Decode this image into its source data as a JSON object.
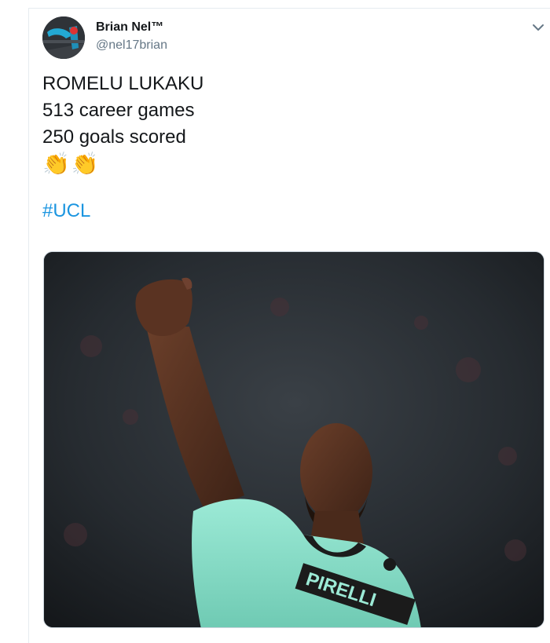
{
  "tweet": {
    "author": {
      "display_name": "Brian Nel™",
      "handle": "@nel17brian"
    },
    "text_lines": [
      "ROMELU LUKAKU",
      "513 career games",
      "250 goals scored"
    ],
    "emojis": [
      "👏",
      "👏"
    ],
    "hashtag": "#UCL",
    "media": {
      "kind": "photo",
      "shirt_text": "PIRELLI"
    }
  },
  "colors": {
    "text_primary": "#14171a",
    "text_secondary": "#657786",
    "link": "#1b95e0",
    "shirt": "#8fe3cf"
  },
  "icons": {
    "menu": "chevron-down-icon",
    "emoji": "clapping-hands-icon"
  }
}
